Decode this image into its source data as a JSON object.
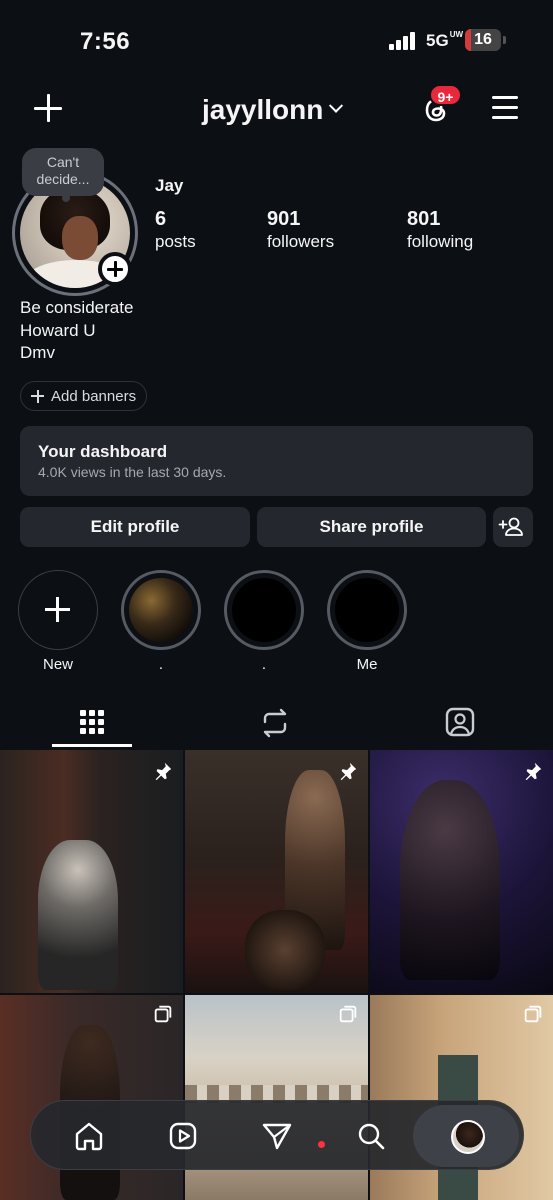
{
  "status_bar": {
    "time": "7:56",
    "network": "5G",
    "network_sup": "UW",
    "battery": "16",
    "battery_level": 0.16
  },
  "header": {
    "username": "jayyllonn",
    "notification_badge": "9+"
  },
  "profile": {
    "note": "Can't decide...",
    "display_name": "Jay",
    "stats": [
      {
        "value": "6",
        "label": "posts"
      },
      {
        "value": "901",
        "label": "followers"
      },
      {
        "value": "801",
        "label": "following"
      }
    ],
    "bio": [
      "Be considerate",
      "Howard U",
      "Dmv"
    ],
    "banner_chip": "Add banners"
  },
  "dashboard": {
    "title": "Your dashboard",
    "subtitle": "4.0K views in the last 30 days."
  },
  "actions": {
    "edit": "Edit profile",
    "share": "Share profile"
  },
  "highlights": [
    {
      "label": "New"
    },
    {
      "label": "."
    },
    {
      "label": "."
    },
    {
      "label": "Me"
    }
  ],
  "tabs": [
    "grid-icon",
    "reposts-icon",
    "tagged-icon"
  ],
  "posts": [
    {
      "pinned": true,
      "multi": false
    },
    {
      "pinned": true,
      "multi": false
    },
    {
      "pinned": true,
      "multi": false
    },
    {
      "pinned": false,
      "multi": true
    },
    {
      "pinned": false,
      "multi": true
    },
    {
      "pinned": false,
      "multi": true
    }
  ],
  "bottom_nav": [
    "home-icon",
    "reels-icon",
    "direct-icon",
    "search-icon",
    "profile-avatar"
  ],
  "colors": {
    "background": "#0c0f14",
    "surface": "#24272d",
    "badge": "#e8283d",
    "battery": "#d23c3c"
  }
}
